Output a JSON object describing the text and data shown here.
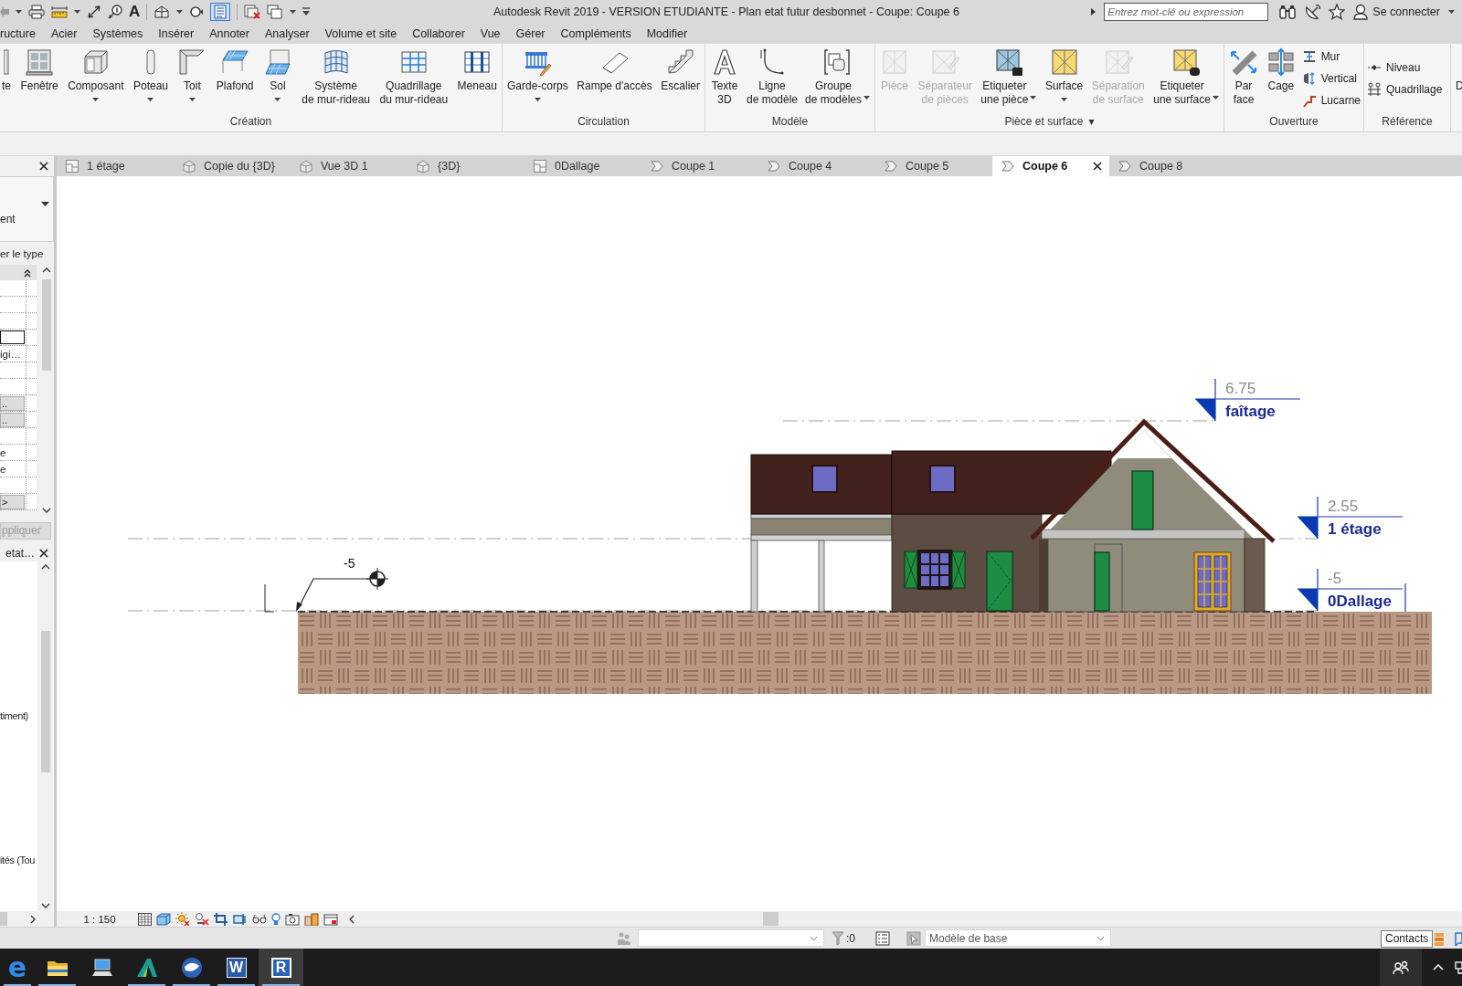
{
  "title_bar": {
    "quick_access": {
      "text_tool_glyph": "A",
      "thin_lines_on": true
    },
    "title": "Autodesk Revit 2019 - VERSION ETUDIANTE - Plan etat futur desbonnet - Coupe: Coupe 6",
    "search": {
      "placeholder": "Entrez mot-clé ou expression"
    },
    "sign_in": "Se connecter"
  },
  "ribbon_tabs": [
    "ructure",
    "Acier",
    "Systèmes",
    "Insérer",
    "Annoter",
    "Analyser",
    "Volume et site",
    "Collaborer",
    "Vue",
    "Gérer",
    "Compléments",
    "Modifier"
  ],
  "ribbon_panels": [
    {
      "title": "Création",
      "buttons": [
        {
          "label": "te",
          "kind": "large",
          "dropdown": false,
          "disabled": false
        },
        {
          "label": "Fenêtre",
          "kind": "large",
          "dropdown": false,
          "disabled": false
        },
        {
          "label": "Composant",
          "kind": "large",
          "dropdown": true,
          "disabled": false
        },
        {
          "label": "Poteau",
          "kind": "large",
          "dropdown": true,
          "disabled": false
        },
        {
          "label": "Toit",
          "kind": "large",
          "dropdown": true,
          "disabled": false
        },
        {
          "label": "Plafond",
          "kind": "large",
          "dropdown": false,
          "disabled": false
        },
        {
          "label": "Sol",
          "kind": "large",
          "dropdown": true,
          "disabled": false
        },
        {
          "label": "Système\nde mur-rideau",
          "kind": "large",
          "dropdown": false,
          "disabled": false
        },
        {
          "label": "Quadrillage\ndu mur-rideau",
          "kind": "large",
          "dropdown": false,
          "disabled": false
        },
        {
          "label": "Meneau",
          "kind": "large",
          "dropdown": false,
          "disabled": false
        }
      ]
    },
    {
      "title": "Circulation",
      "buttons": [
        {
          "label": "Garde-corps",
          "kind": "large",
          "dropdown": true,
          "disabled": false
        },
        {
          "label": "Rampe d'accès",
          "kind": "large",
          "dropdown": false,
          "disabled": false
        },
        {
          "label": "Escalier",
          "kind": "large",
          "dropdown": false,
          "disabled": false
        }
      ]
    },
    {
      "title": "Modèle",
      "buttons": [
        {
          "label": "Texte\n3D",
          "kind": "large",
          "dropdown": false,
          "disabled": false
        },
        {
          "label": "Ligne\nde modèle",
          "kind": "large",
          "dropdown": false,
          "disabled": false
        },
        {
          "label": "Groupe\nde modèles",
          "kind": "large",
          "dropdown": true,
          "disabled": false
        }
      ]
    },
    {
      "title": "Pièce et surface",
      "menu_glyph": "▾",
      "buttons": [
        {
          "label": "Pièce",
          "kind": "large",
          "dropdown": false,
          "disabled": true
        },
        {
          "label": "Séparateur\nde pièces",
          "kind": "large",
          "dropdown": false,
          "disabled": true
        },
        {
          "label": "Etiqueter\nune pièce",
          "kind": "large",
          "dropdown": true,
          "disabled": false
        },
        {
          "label": "Surface",
          "kind": "large",
          "dropdown": true,
          "disabled": false
        },
        {
          "label": "Séparation\nde surface",
          "kind": "large",
          "dropdown": false,
          "disabled": true
        },
        {
          "label": "Etiqueter\nune surface",
          "kind": "large",
          "dropdown": true,
          "disabled": false
        }
      ]
    },
    {
      "title": "Ouverture",
      "buttons": [
        {
          "label": "Par\nface",
          "kind": "large",
          "dropdown": false,
          "disabled": false
        },
        {
          "label": "Cage",
          "kind": "large",
          "dropdown": false,
          "disabled": false
        },
        {
          "label": "Mur",
          "kind": "small",
          "dropdown": false,
          "disabled": false
        },
        {
          "label": "Vertical",
          "kind": "small",
          "dropdown": false,
          "disabled": false
        },
        {
          "label": "Lucarne",
          "kind": "small",
          "dropdown": false,
          "disabled": false
        }
      ]
    },
    {
      "title": "Référence",
      "buttons": [
        {
          "label": "Niveau",
          "kind": "small",
          "dropdown": false,
          "disabled": false
        },
        {
          "label": "Quadrillage",
          "kind": "small",
          "dropdown": false,
          "disabled": false
        }
      ]
    },
    {
      "buttons": [
        {
          "label": "D",
          "kind": "large",
          "dropdown": false,
          "disabled": false
        }
      ]
    }
  ],
  "properties_palette": {
    "type_selector": {
      "value": "ent"
    },
    "edit_type": "er le type",
    "rows": [
      {
        "kind": "blank"
      },
      {
        "kind": "blank"
      },
      {
        "kind": "blank"
      },
      {
        "kind": "field"
      },
      {
        "kind": "text",
        "value": "igi…"
      },
      {
        "kind": "blank"
      },
      {
        "kind": "blank"
      },
      {
        "kind": "button",
        "label": ".."
      },
      {
        "kind": "button",
        "label": ".."
      },
      {
        "kind": "blank"
      },
      {
        "kind": "text",
        "value": "e"
      },
      {
        "kind": "text",
        "value": "e"
      },
      {
        "kind": "blank"
      },
      {
        "kind": "button",
        "label": ">"
      }
    ],
    "apply_button": {
      "label": "ppliquer",
      "disabled": true
    }
  },
  "project_browser": {
    "title": "etat…",
    "items": [
      {
        "label": "timent)"
      },
      {
        "label": "ités (Tou"
      }
    ]
  },
  "view_tabs": [
    {
      "label": "1 étage",
      "kind": "plan",
      "selected": false
    },
    {
      "label": "Copie du {3D}",
      "kind": "perspective",
      "selected": false
    },
    {
      "label": "Vue 3D 1",
      "kind": "perspective",
      "selected": false
    },
    {
      "label": "{3D}",
      "kind": "perspective",
      "selected": false
    },
    {
      "label": "0Dallage",
      "kind": "plan",
      "selected": false
    },
    {
      "label": "Coupe 1",
      "kind": "section",
      "selected": false
    },
    {
      "label": "Coupe 4",
      "kind": "section",
      "selected": false
    },
    {
      "label": "Coupe 5",
      "kind": "section",
      "selected": false
    },
    {
      "label": "Coupe 6",
      "kind": "section",
      "selected": true
    },
    {
      "label": "Coupe 8",
      "kind": "section",
      "selected": false
    }
  ],
  "canvas": {
    "levels": [
      {
        "elevation": "6.75",
        "name": "faîtage"
      },
      {
        "elevation": "2.55",
        "name": "1 étage"
      },
      {
        "elevation": "-5",
        "name": "0Dallage"
      }
    ],
    "spot_elevation": {
      "value": "-5"
    }
  },
  "view_control_bar": {
    "scale": "1 : 150"
  },
  "status_bar": {
    "selection_count": ":0",
    "design_option": {
      "value": "Modèle de base"
    }
  },
  "taskbar": {
    "apps": [
      {
        "glyph": "e",
        "open": true,
        "selected": false
      },
      {
        "open": true,
        "selected": false
      },
      {
        "open": false,
        "selected": false
      },
      {
        "open": true,
        "selected": false
      },
      {
        "open": true,
        "selected": false
      },
      {
        "glyph": "W",
        "open": true,
        "selected": false
      },
      {
        "glyph": "R",
        "open": true,
        "selected": true
      }
    ],
    "tooltip": "Contacts"
  }
}
